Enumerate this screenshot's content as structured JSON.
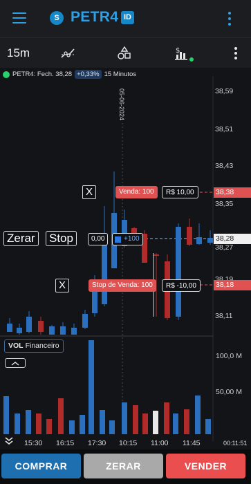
{
  "app_bar": {
    "ticker_badge": "S",
    "ticker": "PETR4",
    "id_badge": "ID"
  },
  "toolbar": {
    "timeframe": "15m",
    "icons": [
      "trendline-icon",
      "shapes-icon",
      "indicators-icon",
      "more-vert-icon"
    ]
  },
  "info": {
    "status": "PETR4: Fech. 38,28",
    "change": "+0,33%",
    "interval": "15 Minutos"
  },
  "price_axis": [
    "38,59",
    "38,51",
    "38,43",
    "38,35",
    "38,27",
    "38,19",
    "38,11"
  ],
  "date_marker": "05-06-2024",
  "orders": {
    "sell_label": "Venda: 100",
    "sell_pnl": "R$ 10,00",
    "sell_price": "38,38",
    "stop_label": "Stop de Venda: 100",
    "stop_pnl": "R$ -10,00",
    "stop_price": "38,18",
    "close_symbol": "X"
  },
  "position": {
    "zerar": "Zerar",
    "stop": "Stop",
    "avg": "0,00",
    "qty": "+100",
    "current_price": "38,28"
  },
  "volume": {
    "label_bold": "VOL",
    "label": "Financeiro",
    "axis": [
      "100,0 M",
      "50,00 M"
    ]
  },
  "time_axis": [
    "15:30",
    "16:15",
    "17:30",
    "10:15",
    "11:00",
    "11:45"
  ],
  "clock": "00:11:51",
  "actions": {
    "buy": "COMPRAR",
    "zero": "ZERAR",
    "sell": "VENDER"
  },
  "colors": {
    "accent": "#2ea0e6",
    "bull": "#2b6fbf",
    "bear": "#b22b2b",
    "sell": "#e05252",
    "buy_button": "#1d6fb0"
  }
}
